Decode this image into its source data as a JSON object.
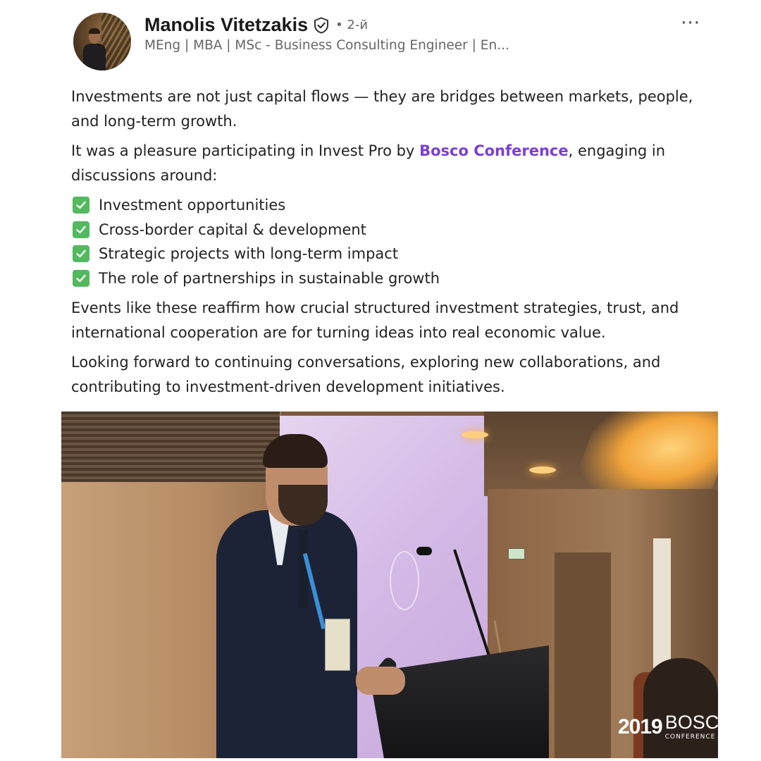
{
  "author": {
    "name": "Manolis Vitetzakis",
    "degree": "• 2-й",
    "headline": "MEng | MBA | MSc - Business Consulting Engineer | En..."
  },
  "menu": {
    "more_label": "···"
  },
  "post": {
    "p1": "Investments are not just capital flows — they are bridges between markets, people, and long-term growth.",
    "p2_before": "It was a pleasure participating in Invest Pro by ",
    "p2_link": "Bosco Conference",
    "p2_after": ", engaging in discussions around:",
    "checklist": [
      "Investment opportunities",
      "Cross-border capital & development",
      "Strategic projects with long-term impact",
      "The role of partnerships in sustainable growth"
    ],
    "p3": "Events like these reaffirm how crucial structured investment strategies, trust, and international cooperation are for turning ideas into real economic value.",
    "p4": "Looking forward to continuing conversations, exploring new collaborations, and contributing to investment-driven development initiatives."
  },
  "photo": {
    "watermark_number": "2019",
    "watermark_brand": "BOSCO",
    "watermark_sub": "CONFERENCE"
  },
  "colors": {
    "link": "#7b3fd6",
    "check": "#52b95e",
    "secondary_text": "#666666"
  },
  "icons": [
    "verified-shield-icon",
    "more-options-icon",
    "checkmark-icon"
  ]
}
